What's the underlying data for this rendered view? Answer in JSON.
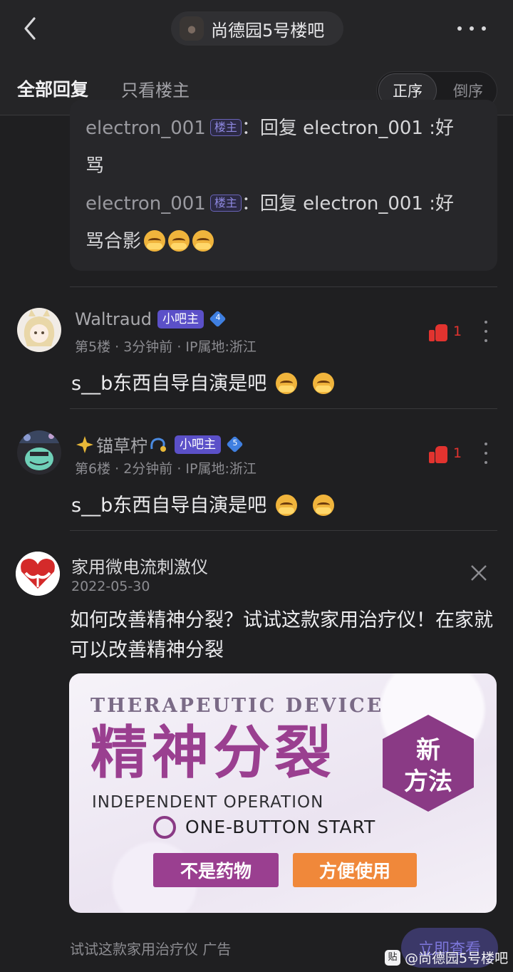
{
  "header": {
    "forum_name": "尚德园5号楼吧"
  },
  "tabs": {
    "all": "全部回复",
    "op_only": "只看楼主",
    "order_asc": "正序",
    "order_desc": "倒序"
  },
  "quote": {
    "lines": [
      {
        "user": "electron_001",
        "tag": "楼主",
        "colon": "：",
        "text_1": "回复 electron_001 :好",
        "text_2": "骂"
      },
      {
        "user": "electron_001",
        "tag": "楼主",
        "colon": "：",
        "text_1": "回复 electron_001 :好",
        "text_2": "骂合影"
      }
    ]
  },
  "posts": [
    {
      "user": "Waltraud",
      "badge": "小吧主",
      "level": "4",
      "meta": "第5楼 · 3分钟前 · IP属地:浙江",
      "likes": "1",
      "text": "s__b东西自导自演是吧"
    },
    {
      "user": "锚草柠",
      "badge": "小吧主",
      "level": "5",
      "meta": "第6楼 · 2分钟前 · IP属地:浙江",
      "likes": "1",
      "text": "s__b东西自导自演是吧"
    }
  ],
  "ad": {
    "brand": "家用微电流刺激仪",
    "date": "2022-05-30",
    "text": "如何改善精神分裂？试试这款家用治疗仪！在家就可以改善精神分裂",
    "banner": {
      "eng_title": "THERAPEUTIC DEVICE",
      "big_title": "精神分裂",
      "hex_line1": "新",
      "hex_line2": "方法",
      "sub1": "INDEPENDENT OPERATION",
      "sub2": "ONE-BUTTON START",
      "btn1": "不是药物",
      "btn2": "方便使用"
    },
    "footer": "试试这款家用治疗仪  广告",
    "cta": "立即查看"
  },
  "watermark": {
    "logo": "贴",
    "text": "@尚德园5号楼吧"
  },
  "colors": {
    "accent": "#5b50c8",
    "like_red": "#e2332f",
    "banner_purple": "#9a3f90",
    "banner_orange": "#f0883a"
  }
}
